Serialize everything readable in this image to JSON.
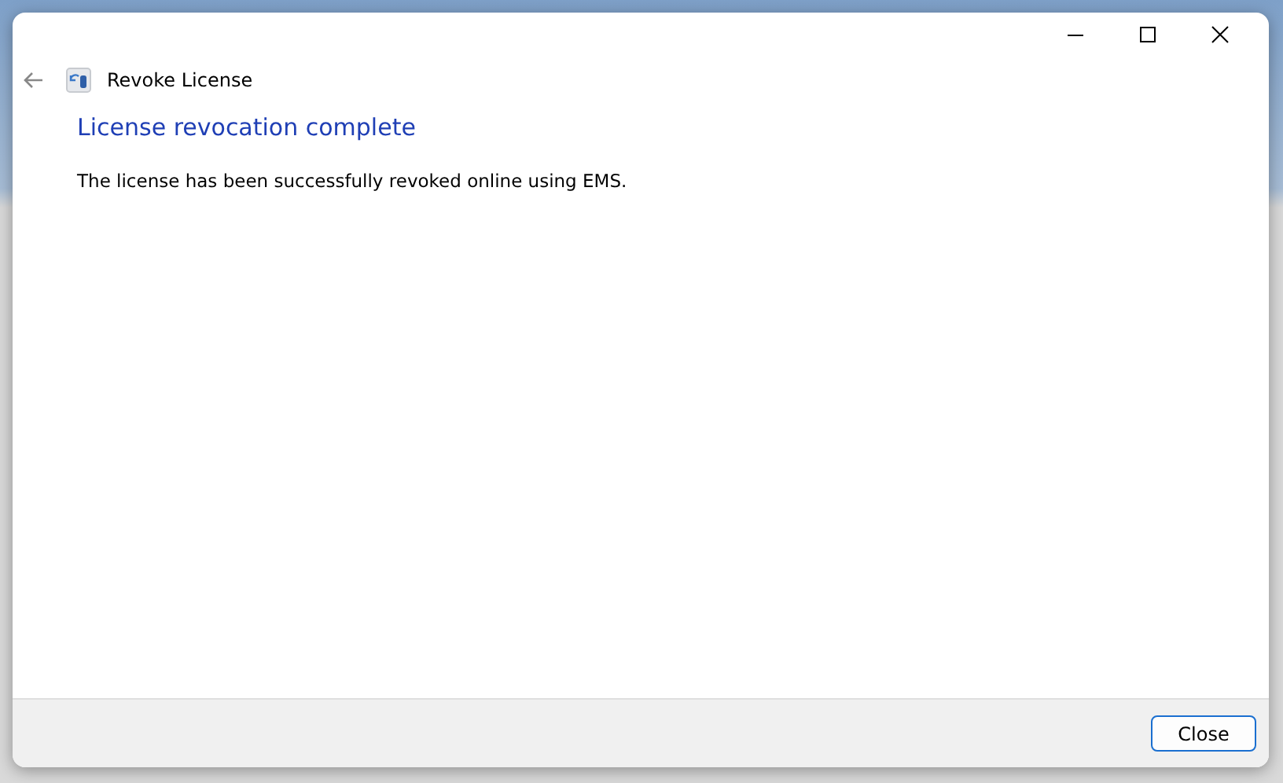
{
  "window": {
    "title": "Revoke License"
  },
  "heading": "License revocation complete",
  "message": "The license has been successfully revoked online using EMS.",
  "buttons": [
    {
      "label": "Close",
      "selected": true
    }
  ]
}
